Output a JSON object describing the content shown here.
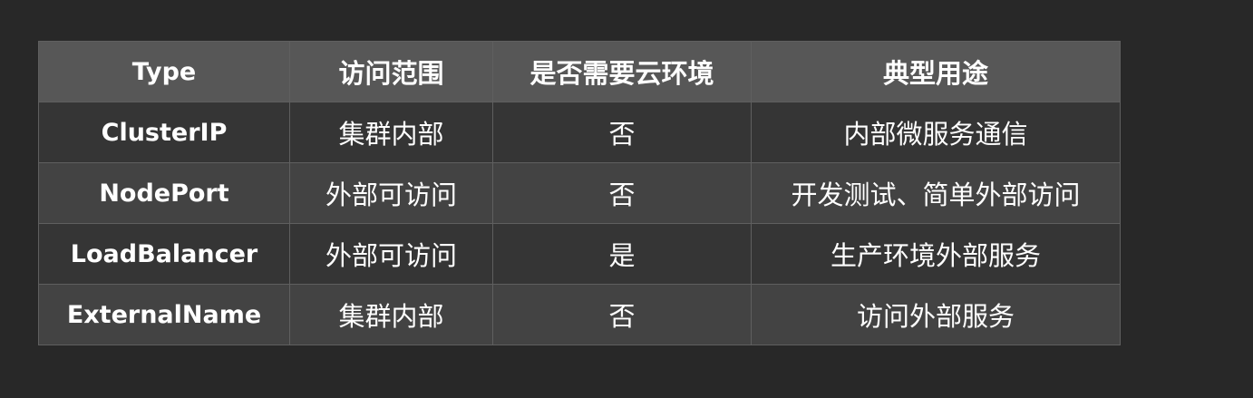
{
  "table": {
    "headers": [
      "Type",
      "访问范围",
      "是否需要云环境",
      "典型用途"
    ],
    "rows": [
      [
        "ClusterIP",
        "集群内部",
        "否",
        "内部微服务通信"
      ],
      [
        "NodePort",
        "外部可访问",
        "否",
        "开发测试、简单外部访问"
      ],
      [
        "LoadBalancer",
        "外部可访问",
        "是",
        "生产环境外部服务"
      ],
      [
        "ExternalName",
        "集群内部",
        "否",
        "访问外部服务"
      ]
    ]
  },
  "colors": {
    "page_background": "#282828",
    "header_background": "#575757",
    "row_odd_background": "#353535",
    "row_even_background": "#434343",
    "border": "#5f5f5f",
    "text": "#ffffff"
  }
}
